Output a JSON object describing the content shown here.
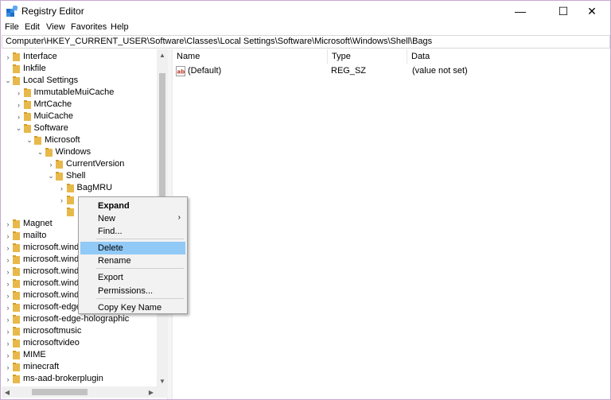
{
  "window": {
    "title": "Registry Editor",
    "controls": {
      "minimize": "—",
      "maximize": "☐",
      "close": "✕"
    }
  },
  "menu": [
    "File",
    "Edit",
    "View",
    "Favorites",
    "Help"
  ],
  "address": "Computer\\HKEY_CURRENT_USER\\Software\\Classes\\Local Settings\\Software\\Microsoft\\Windows\\Shell\\Bags",
  "tree": [
    {
      "label": "Interface",
      "chevron": "›"
    },
    {
      "label": "Inkfile",
      "chevron": ""
    },
    {
      "label": "Local Settings",
      "chevron": "⌄"
    },
    {
      "label": "ImmutableMuiCache",
      "chevron": "›"
    },
    {
      "label": "MrtCache",
      "chevron": "›"
    },
    {
      "label": "MuiCache",
      "chevron": "›"
    },
    {
      "label": "Software",
      "chevron": "⌄"
    },
    {
      "label": "Microsoft",
      "chevron": "⌄"
    },
    {
      "label": "Windows",
      "chevron": "⌄"
    },
    {
      "label": "CurrentVersion",
      "chevron": "›"
    },
    {
      "label": "Shell",
      "chevron": "⌄"
    },
    {
      "label": "BagMRU",
      "chevron": "›"
    },
    {
      "label": "",
      "chevron": "›"
    },
    {
      "label": "",
      "chevron": ""
    },
    {
      "label": "Magnet",
      "chevron": "›"
    },
    {
      "label": "mailto",
      "chevron": "›"
    },
    {
      "label": "microsoft.windo",
      "chevron": "›"
    },
    {
      "label": "microsoft.windo",
      "chevron": "›"
    },
    {
      "label": "microsoft.windo",
      "chevron": "›"
    },
    {
      "label": "microsoft.windo",
      "chevron": "›"
    },
    {
      "label": "microsoft.windo",
      "chevron": "›"
    },
    {
      "label": "microsoft-edge",
      "chevron": "›"
    },
    {
      "label": "microsoft-edge-holographic",
      "chevron": "›"
    },
    {
      "label": "microsoftmusic",
      "chevron": "›"
    },
    {
      "label": "microsoftvideo",
      "chevron": "›"
    },
    {
      "label": "MIME",
      "chevron": "›"
    },
    {
      "label": "minecraft",
      "chevron": "›"
    },
    {
      "label": "ms-aad-brokerplugin",
      "chevron": "›"
    }
  ],
  "list": {
    "columns": [
      "Name",
      "Type",
      "Data"
    ],
    "rows": [
      {
        "name": "(Default)",
        "type": "REG_SZ",
        "data": "(value not set)"
      }
    ]
  },
  "context_menu": {
    "items": [
      {
        "label": "Expand",
        "bold": true,
        "submenu": false,
        "highlight": false
      },
      {
        "label": "New",
        "bold": false,
        "submenu": true,
        "highlight": false
      },
      {
        "label": "Find...",
        "bold": false,
        "submenu": false,
        "highlight": false
      },
      {
        "label": "Delete",
        "bold": false,
        "submenu": false,
        "highlight": true
      },
      {
        "label": "Rename",
        "bold": false,
        "submenu": false,
        "highlight": false
      },
      {
        "label": "Export",
        "bold": false,
        "submenu": false,
        "highlight": false
      },
      {
        "label": "Permissions...",
        "bold": false,
        "submenu": false,
        "highlight": false
      },
      {
        "label": "Copy Key Name",
        "bold": false,
        "submenu": false,
        "highlight": false
      }
    ],
    "submenu_arrow": "›"
  },
  "colors": {
    "folder": "#e8b94a",
    "folder_dark": "#d19d2a",
    "highlight": "#91c9f7",
    "border_accent": "#c9a7d3"
  },
  "icons": {
    "app": "registry-icon",
    "folder": "folder-icon",
    "value": "reg-sz-icon",
    "scroll_up": "▲",
    "scroll_down": "▼",
    "scroll_left": "◀",
    "scroll_right": "▶"
  }
}
